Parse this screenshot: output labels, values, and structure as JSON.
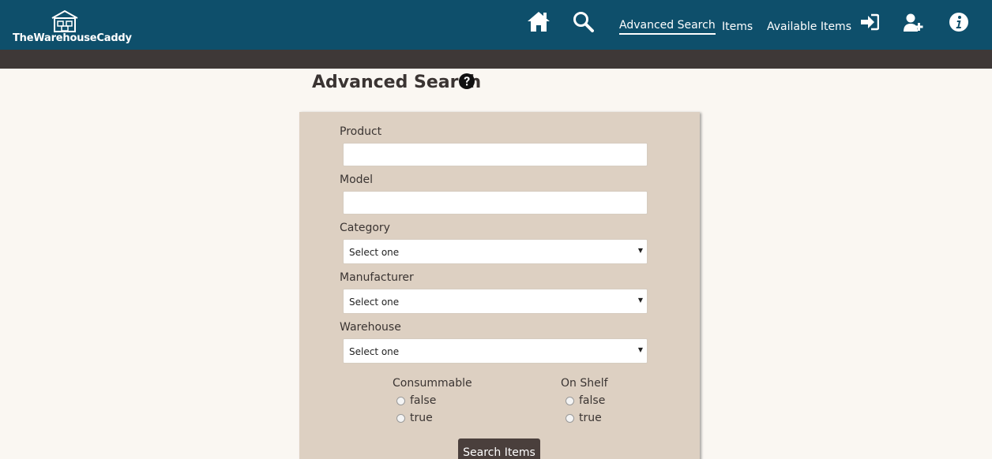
{
  "brand": {
    "name": "TheWarehouseCaddy"
  },
  "nav": {
    "home_icon": "home-icon",
    "search_icon": "search-icon",
    "links": [
      "Advanced Search",
      "Items",
      "Available Items"
    ],
    "login_icon": "sign-in-icon",
    "register_icon": "user-plus-icon",
    "info_icon": "info-icon"
  },
  "page": {
    "title": "Advanced Search",
    "help_icon": "question-circle-icon"
  },
  "form": {
    "product_label": "Product",
    "product_value": "",
    "model_label": "Model",
    "model_value": "",
    "category_label": "Category",
    "category_value": "Select one",
    "manufacturer_label": "Manufacturer",
    "manufacturer_value": "Select one",
    "warehouse_label": "Warehouse",
    "warehouse_value": "Select one",
    "consumable": {
      "label": "Consummable",
      "options": [
        "false",
        "true"
      ]
    },
    "on_shelf": {
      "label": "On Shelf",
      "options": [
        "false",
        "true"
      ]
    },
    "submit_label": "Search Items"
  },
  "colors": {
    "navbar": "#0e4f6b",
    "subbar": "#3e3837",
    "panel": "#ddd0c2",
    "background": "#faf7f2",
    "button": "#4a3f3c"
  }
}
